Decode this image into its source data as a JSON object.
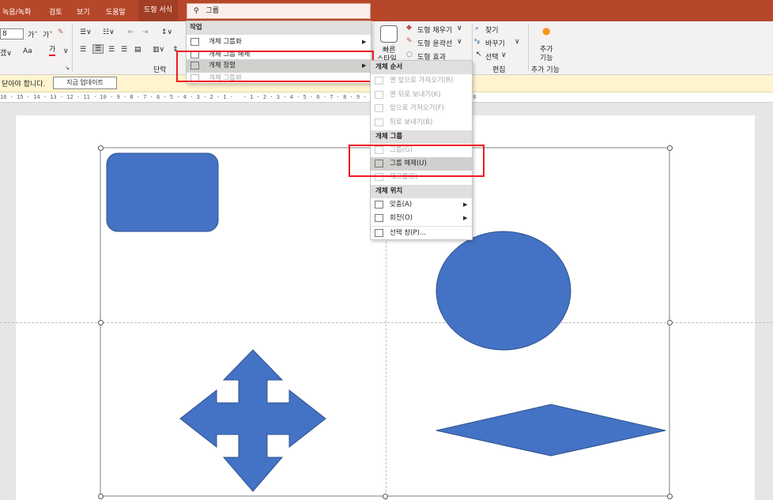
{
  "tabs": [
    "녹음/녹화",
    "검토",
    "보기",
    "도움말",
    "도형 서식"
  ],
  "search": {
    "text": "그룹"
  },
  "ribbon": {
    "font_size": "8",
    "group_paragraph": "단락",
    "quick_style_line1": "빠른",
    "quick_style_line2": "스타일",
    "fill": "도형 채우기",
    "outline": "도형 윤곽선",
    "effect": "도형 효과",
    "find": "찾기",
    "replace": "바꾸기",
    "select": "선택",
    "group_editing": "편집",
    "addin_line1": "추가",
    "addin_line2": "기능",
    "group_addins": "추가 기능",
    "text_aa": "Aa"
  },
  "notify": {
    "text": "닫아야 합니다.",
    "button": "지금 업데이트"
  },
  "ruler": "16 · 15 · 14 · 13 · 12 · 11 · 10 · 9 · 8 · 7 · 6 · 5 · 4 · 3 · 2 · 1 ·   · 1 · 2 · 3 · 4 · 5 · 6 · 7 · 8 · 9 · 10 · 11 · 12 · 13 · 14 · 15 · 16",
  "menu1": {
    "header": "작업",
    "items": [
      "개체 그룹화",
      "개체 그룹 해제",
      "개체 정렬",
      "개체 그룹화"
    ]
  },
  "menu2": {
    "header_order": "개체 순서",
    "order": [
      "맨 앞으로 가져오기(R)",
      "맨 뒤로 보내기(K)",
      "앞으로 가져오기(F)",
      "뒤로 보내기(B)"
    ],
    "header_group": "개체 그룹",
    "group": [
      "그룹(G)",
      "그룹 해제(U)",
      "재그룹(E)"
    ],
    "header_pos": "개체 위치",
    "pos": [
      "맞춤(A)",
      "회전(O)",
      "선택 창(P)..."
    ]
  },
  "colors": {
    "accent": "#b7472a",
    "shape_fill": "#4472c4",
    "shape_stroke": "#2f528f",
    "highlight_red": "#ec1c24"
  }
}
